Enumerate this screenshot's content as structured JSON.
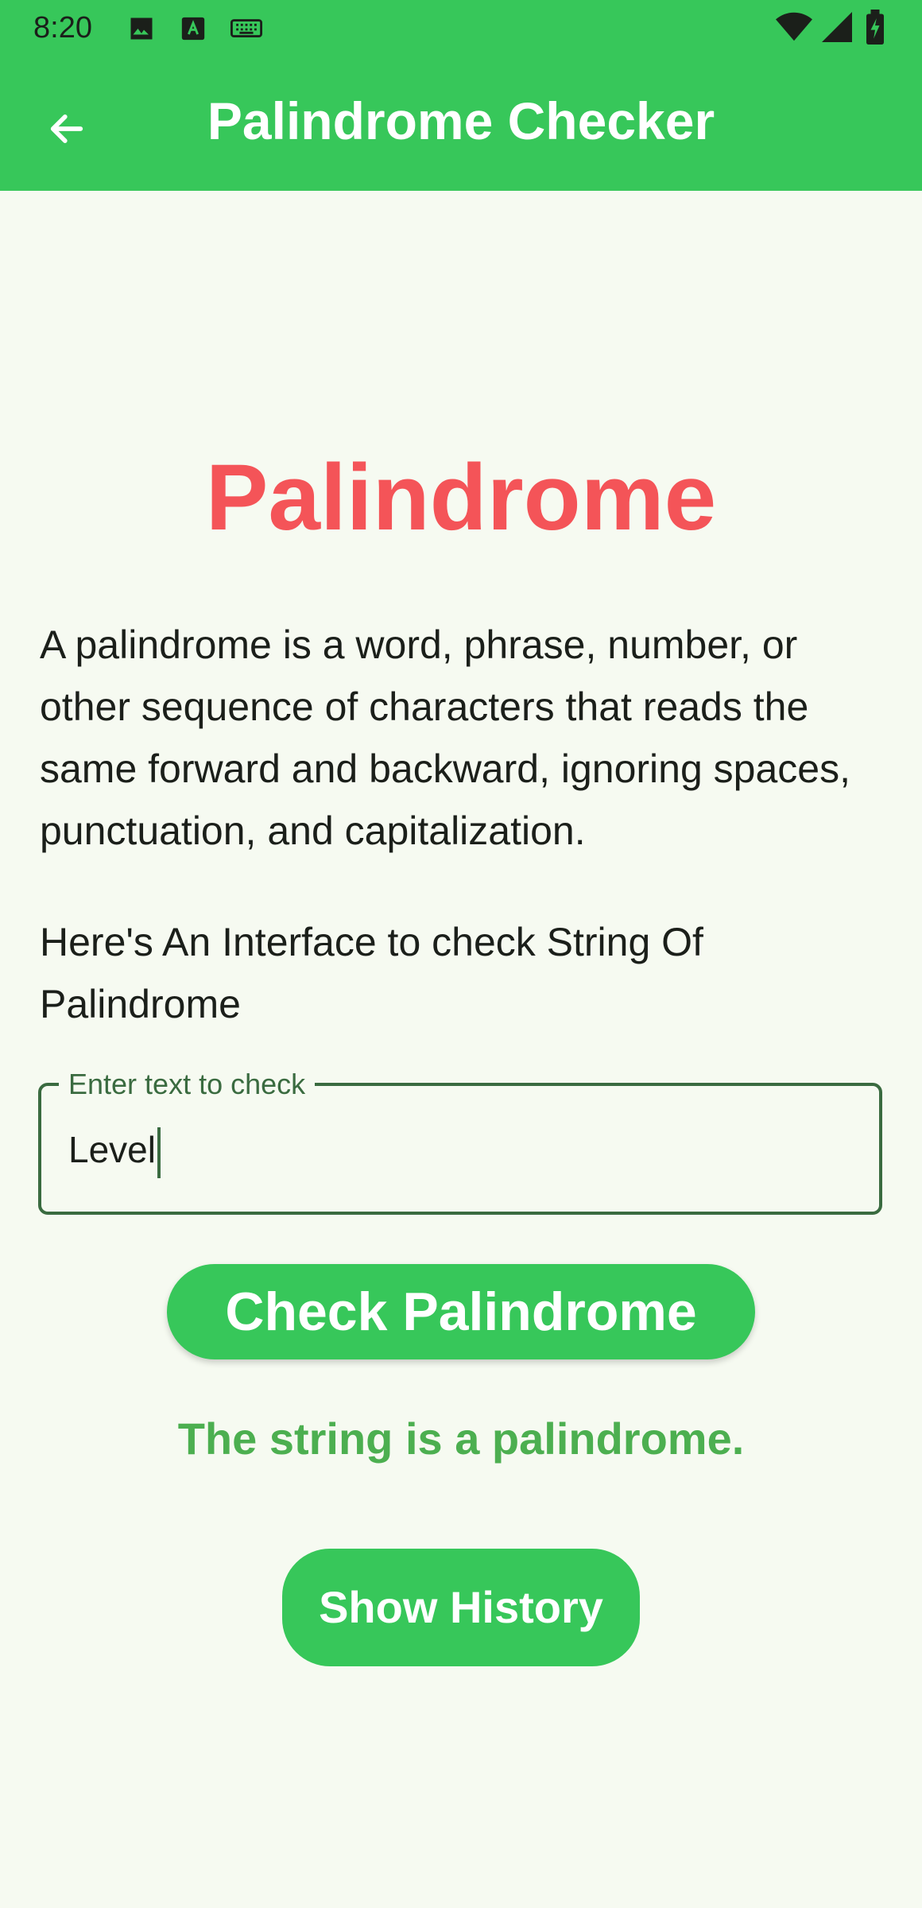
{
  "status_bar": {
    "time": "8:20",
    "left_icons": [
      "image-icon",
      "text-a-icon",
      "keyboard-icon"
    ],
    "right_icons": [
      "wifi-icon",
      "signal-icon",
      "battery-icon"
    ]
  },
  "app_bar": {
    "back_icon": "arrow-back-icon",
    "title": "Palindrome Checker"
  },
  "main": {
    "heading": "Palindrome",
    "description": "A palindrome is a word, phrase, number, or other sequence of characters that reads the same forward and backward, ignoring spaces, punctuation, and capitalization.",
    "interface_text": "Here's An Interface to check String Of Palindrome",
    "input": {
      "label": "Enter text to check",
      "value": "Level"
    },
    "check_button_label": "Check Palindrome",
    "result_text": "The string is a palindrome.",
    "history_button_label": "Show History"
  },
  "colors": {
    "primary": "#37c75a",
    "heading": "#f45458",
    "result": "#4caf50",
    "outline": "#3a6b40",
    "background": "#f6faf1"
  }
}
